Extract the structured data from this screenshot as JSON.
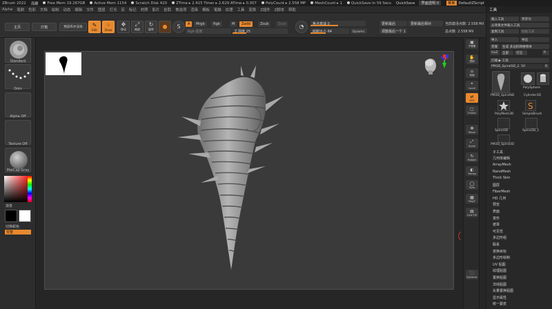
{
  "titlebar": {
    "app": "ZBrush 2022",
    "doc": "海螺",
    "stats": [
      "Free Mem 19.267GB",
      "Active Mem 1154",
      "Scratch Disk 420",
      "ZTime ▸ 2.415 Timer ▸ 2.629 ATime ▸ 0.007",
      "PolyCount ▸ 2.558 MP",
      "MeshCount ▸ 1",
      "QuickSave In 59 Secs"
    ],
    "quicksave": "QuickSave",
    "transparency": "界面透明 0",
    "menu_btn": "菜单",
    "script": "DefaultZScript"
  },
  "menubar": [
    "Alpha",
    "笔刷",
    "色彩",
    "文档",
    "绘制",
    "动态",
    "编辑",
    "文件",
    "图层",
    "灯光",
    "宏",
    "标记",
    "材质",
    "影片",
    "拾取",
    "首选项",
    "渲染",
    "模板",
    "笔触",
    "纹理",
    "工具",
    "变换",
    "Z插件",
    "Z脚本",
    "帮助"
  ],
  "toolbar": {
    "home": "主页",
    "light_box": "灯箱",
    "preview": "预览布尔渲染",
    "edit": "Edit",
    "draw": "Draw",
    "move": "移动",
    "scale": "缩放",
    "rotate": "旋转",
    "a_label": "A",
    "mrgb": "Mrgb",
    "rgb": "Rgb",
    "m": "M",
    "zadd": "Zadd",
    "zsub": "Zsub",
    "zcut": "Zcut",
    "rgb_intensity": "Rgb 强度",
    "z_intensity": "Z 强度 25",
    "z_value": 25,
    "focal_shift": "焦点衰减 0",
    "draw_size": "绘制大小 64",
    "dynamic": "Dynamic",
    "active_points": "当前激活点数: 2.558 Mil",
    "total_points": "总点数: 2.558 Mil",
    "update_last": "更新最后",
    "update_relative": "更新最后相对",
    "adjust_last": "调整最后一个 1"
  },
  "lefttray": {
    "brush": "Standard",
    "stroke": "Dots",
    "alpha": "Alpha Off",
    "texture": "Texture Off",
    "material": "MatCap Gray",
    "gradient": "渐变",
    "switch_color": "切换颜色",
    "alternate": "交替"
  },
  "rightshelf": [
    "子像素",
    "透视",
    "地面",
    "Local",
    "XYZ",
    "Frame",
    "Move",
    "Scale",
    "Rotate",
    "Transp",
    "Solo",
    "PolyF",
    "Line Fill",
    "Dynamic"
  ],
  "panel": {
    "title": "工具",
    "buttons": [
      "载入工具",
      "另存为",
      "从项目文件载入工具",
      "复制工具",
      "粘贴工具",
      "导入",
      "导出",
      "克隆",
      "生成 多边形网格物体",
      "GoZ",
      "全部",
      "可见",
      "R"
    ],
    "lightbox_tools": "灯箱 ▶ 工具",
    "current_tool": "PM3D_SpiralSD_2. 50",
    "thumbs": [
      "PM3D_SpiralSD",
      "PolySphere",
      "Cylinder3D",
      "PolyMesh3D",
      "SimpleBrush",
      "Spiral3D",
      "Spiral3D_1",
      "PM3D_Spiral3D"
    ],
    "subpalettes": [
      "子工具",
      "几何体编辑",
      "ArrayMesh",
      "NanoMesh",
      "Thick Skin",
      "图层",
      "FiberMesh",
      "HD 几何",
      "预览",
      "表面",
      "变形",
      "遮罩",
      "可见性",
      "多边形组",
      "联系",
      "变换目标",
      "多边形绘制",
      "UV 贴图",
      "纹理贴图",
      "置换贴图",
      "法线贴图",
      "矢量置换贴图",
      "显示属性",
      "统一蒙皮"
    ]
  },
  "colors": {
    "accent": "#e9892e",
    "bg": "#262626",
    "canvas": "#3a3a3a"
  }
}
